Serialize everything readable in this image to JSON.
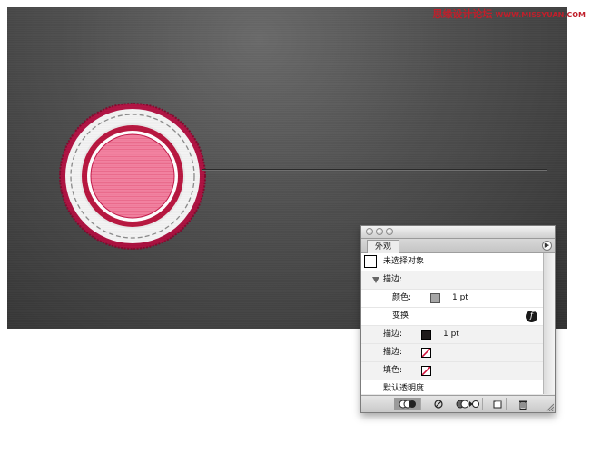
{
  "watermark": {
    "text": "思缘设计论坛",
    "domain": "WWW.MISSYUAN.COM"
  },
  "panel": {
    "tab_label": "外观",
    "menu_glyph": "▶",
    "rows": [
      {
        "label": "未选择对象"
      },
      {
        "label": "描边:"
      },
      {
        "label": "颜色:",
        "value": "1 pt"
      },
      {
        "label": "变换"
      },
      {
        "label": "描边:",
        "value": "1 pt"
      },
      {
        "label": "描边:"
      },
      {
        "label": "填色:"
      },
      {
        "label": "默认透明度"
      }
    ],
    "fx_glyph": "f"
  },
  "colors": {
    "badge_outer": "#c0184c",
    "badge_ring": "#f4f4f4",
    "badge_inner_border": "#b8163f",
    "badge_inner_fill": "#f07a9a",
    "stitch": "#8a8a8a"
  },
  "icons": {
    "new_art_basic": "basic-appearance-icon",
    "clear": "clear-appearance-icon",
    "reduce": "reduce-to-basic-icon",
    "duplicate": "duplicate-item-icon",
    "delete": "trash-icon"
  }
}
